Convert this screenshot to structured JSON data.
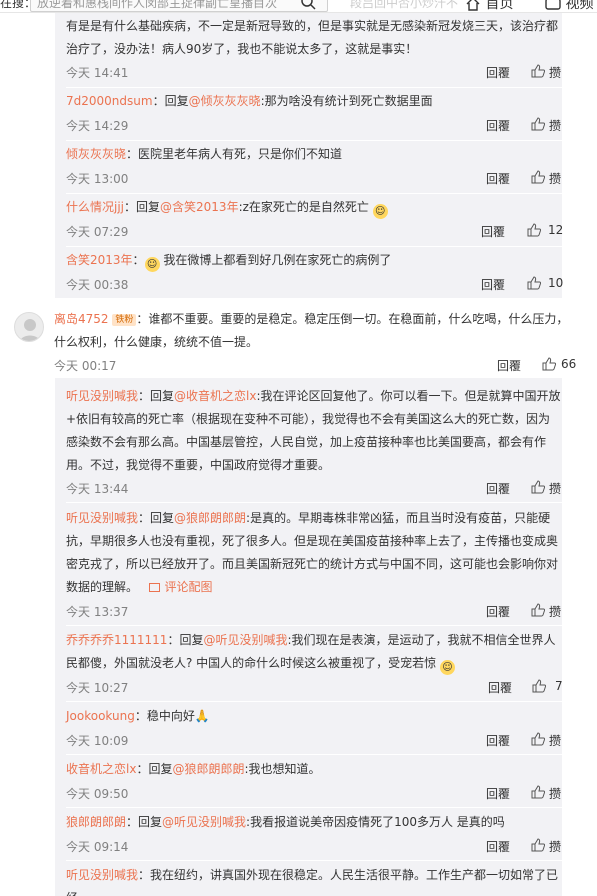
{
  "topbar": {
    "search_prefix": "在搜：",
    "search_text": "放逆着和惠栈间作人闵部主捉律副亡皇播目次",
    "nav_hint": "段吕回中否小炒汗不",
    "home_label": "首页",
    "video_label": "视频"
  },
  "actions": {
    "reply": "回覆",
    "like_icon": "thumbs-up-icon"
  },
  "thread1": [
    {
      "text": "有是是有什么基础疾病，不一定是新冠导致的，但是事实就是无感染新冠发烧三天，该治疗都治疗了，没办法！病人90岁了，我也不能说太多了，这就是事实！",
      "time": "今天 14:41",
      "likes": "攒"
    },
    {
      "user": "7d2000ndsum",
      "sep": "：回复",
      "at": "@倾灰灰灰晓",
      "body": ":那为啥没有统计到死亡数据里面",
      "time": "今天 14:29",
      "likes": "攒"
    },
    {
      "user": "倾灰灰灰晓",
      "sep": "：",
      "body": "医院里老年病人有死，只是你们不知道",
      "time": "今天 13:00",
      "likes": "攒"
    },
    {
      "user": "什么情况jjj",
      "sep": "：回复",
      "at": "@含笑2013年",
      "body": ":z在家死亡的是自然死亡",
      "time": "今天 07:29",
      "likes": "12"
    },
    {
      "user": "含笑2013年",
      "sep": "：",
      "body": "我在微博上都看到好几例在家死亡的病例了",
      "time": "今天 00:38",
      "likes": "10"
    }
  ],
  "main_comment": {
    "user": "离岛4752",
    "badge": "铁粉",
    "body": "谁都不重要。重要的是稳定。稳定压倒一切。在稳面前，什么吃喝，什么压力，什么权利，什么健康，统统不值一提。",
    "time": "今天 00:17",
    "likes": "66"
  },
  "thread2": [
    {
      "user": "听见没别喊我",
      "sep": "：回复",
      "at": "@收音机之恋lx",
      "body": ":我在评论区回复他了。你可以看一下。但是就算中国开放+依旧有较高的死亡率（根据现在变种不可能），我觉得也不会有美国这么大的死亡数，因为感染数不会有那么高。中国基层管控，人民自觉，加上疫苗接种率也比美国要高，都会有作用。不过，我觉得不重要，中国政府觉得才重要。",
      "time": "今天 13:44",
      "likes": "攒"
    },
    {
      "user": "听见没别喊我",
      "sep": "：回复",
      "at": "@狼郎朗郎朗",
      "body": ":是真的。早期毒株非常凶猛，而且当时没有疫苗，只能硬抗，早期很多人也没有重视，死了很多人。但是现在美国疫苗接种率上去了，主传播也变成奥密克戎了，所以已经放开了。而且美国新冠死亡的统计方式与中国不同，这可能也会影响你对数据的理解。",
      "pic": "评论配图",
      "time": "今天 13:37",
      "likes": "攒"
    },
    {
      "user": "乔乔乔乔1111111",
      "sep": "：回复",
      "at": "@听见没别喊我",
      "body": ":我们现在是表演，是运动了，我就不相信全世界人民都傻，外国就没老人? 中国人的命什么时候这么被重视了，受宠若惊",
      "time": "今天 10:27",
      "likes": "7"
    },
    {
      "user": "Jookookung",
      "sep": "：",
      "body": "稳中向好",
      "time": "今天 10:09",
      "likes": "攒"
    },
    {
      "user": "收音机之恋lx",
      "sep": "：回复",
      "at": "@狼郎朗郎朗",
      "body": ":我也想知道。",
      "time": "今天 09:50",
      "likes": "攒"
    },
    {
      "user": "狼郎朗郎朗",
      "sep": "：回复",
      "at": "@听见没别喊我",
      "body": ":我看报道说美帝因疫情死了100多万人 是真的吗",
      "time": "今天 09:14",
      "likes": "攒"
    },
    {
      "user": "听见没别喊我",
      "sep": "：",
      "body": "我在纽约，讲真国外现在很稳定。人民生活很平静。工作生产都一切如常了已经"
    }
  ],
  "colors": {
    "link": "#eb7350",
    "sub_bg": "#f2f2f5",
    "time": "#808080"
  }
}
